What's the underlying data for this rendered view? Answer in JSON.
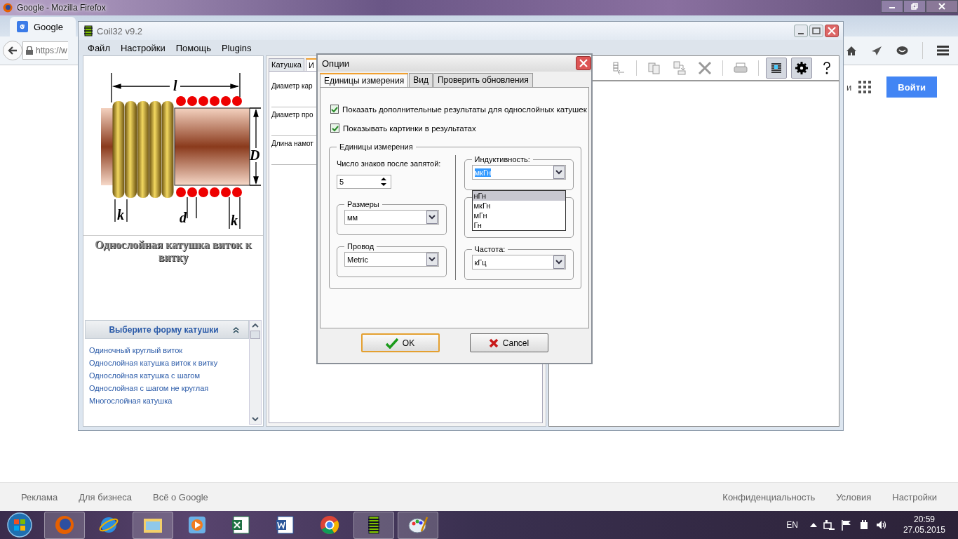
{
  "browser": {
    "window_title": "Google - Mozilla Firefox",
    "tab": {
      "label": "Google",
      "selected": true
    },
    "url": "https://w",
    "partial_text": "и",
    "sign_in": "Войти",
    "footer_left": [
      "Реклама",
      "Для бизнеса",
      "Всё о Google"
    ],
    "footer_right": [
      "Конфиденциальность",
      "Условия",
      "Настройки"
    ]
  },
  "app": {
    "title": "Coil32 v9.2",
    "menu": [
      "Файл",
      "Настройки",
      "Помощь",
      "Plugins"
    ],
    "diagram_labels": {
      "length": "l",
      "diameter": "D",
      "pitch_left": "k",
      "wire": "d",
      "pitch_right": "k"
    },
    "caption": "Однослойная катушка виток к витку",
    "shape_panel": {
      "title": "Выберите форму катушки",
      "items": [
        "Одиночный круглый виток",
        "Однослойная катушка виток к витку",
        "Однослойная катушка с шагом",
        "Однослойная с шагом не круглая",
        "Многослойная катушка"
      ]
    },
    "tabs": [
      {
        "label": "Катушка",
        "selected": false
      },
      {
        "label": "И",
        "selected": true
      }
    ],
    "fields": [
      "Диаметр кар",
      "Диаметр про",
      "Длина намот"
    ],
    "toolbar": [
      {
        "kind": "list",
        "pressed": false
      },
      {
        "kind": "copy",
        "pressed": false
      },
      {
        "kind": "export",
        "pressed": false
      },
      {
        "kind": "clear",
        "pressed": false
      },
      {
        "kind": "print",
        "pressed": false
      },
      {
        "kind": "table",
        "pressed": true
      },
      {
        "kind": "gear",
        "pressed": true
      },
      {
        "kind": "help",
        "pressed": false
      }
    ]
  },
  "dialog": {
    "title": "Опции",
    "tabs": [
      {
        "label": "Единицы измерения",
        "selected": true
      },
      {
        "label": "Вид",
        "selected": false
      },
      {
        "label": "Проверить обновления",
        "selected": false
      }
    ],
    "checkboxes": [
      {
        "label": "Показать дополнительные результаты для однослойных катушек",
        "checked": true
      },
      {
        "label": "Показывать картинки в результатах",
        "checked": true
      }
    ],
    "group_title": "Единицы измерения",
    "decimals_label": "Число знаков после запятой:",
    "decimals_value": "5",
    "left_groups": [
      {
        "title": "Размеры",
        "value": "мм"
      },
      {
        "title": "Провод",
        "value": "Metric"
      }
    ],
    "inductance": {
      "title": "Индуктивность:",
      "value": "мкГн",
      "options": [
        {
          "label": "нГн",
          "highlighted": true
        },
        {
          "label": "мкГн",
          "highlighted": false
        },
        {
          "label": "мГн",
          "highlighted": false
        },
        {
          "label": "Гн",
          "highlighted": false
        }
      ]
    },
    "frequency": {
      "title": "Частота:",
      "value": "кГц"
    },
    "buttons": [
      {
        "label": "OK",
        "kind": "ok"
      },
      {
        "label": "Cancel",
        "kind": "cancel"
      }
    ]
  },
  "taskbar": {
    "apps": [
      {
        "kind": "firefox",
        "active": true
      },
      {
        "kind": "ie",
        "active": false
      },
      {
        "kind": "folder",
        "active": true
      },
      {
        "kind": "player",
        "active": false
      },
      {
        "kind": "excel",
        "active": false
      },
      {
        "kind": "word",
        "active": false
      },
      {
        "kind": "chrome",
        "active": false
      },
      {
        "kind": "coil",
        "active": true
      },
      {
        "kind": "paint",
        "active": true
      }
    ],
    "language": "EN",
    "time": "20:59",
    "date": "27.05.2015"
  }
}
